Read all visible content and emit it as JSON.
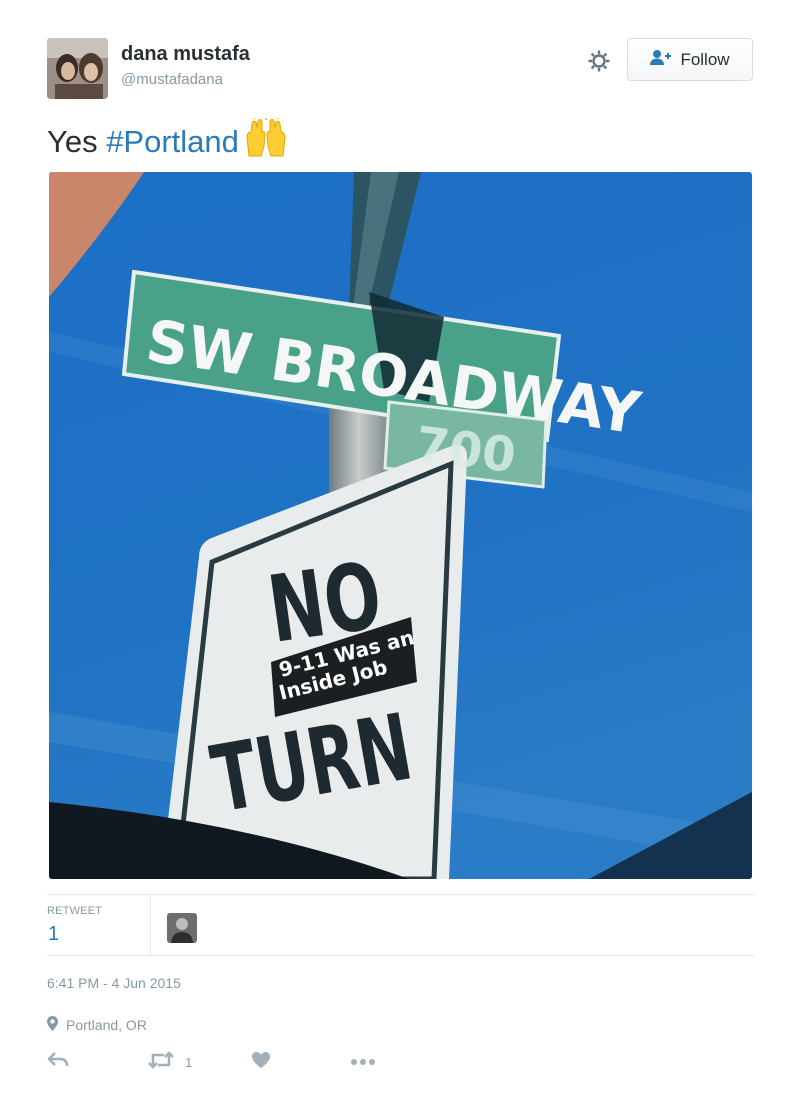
{
  "user": {
    "name": "dana mustafa",
    "handle": "@mustafadana"
  },
  "header": {
    "follow_label": "Follow"
  },
  "tweet": {
    "text_prefix": "Yes ",
    "hashtag": "#Portland",
    "emoji": "raised-hands-emoji"
  },
  "photo": {
    "street_sign": "SW BROADWAY",
    "block_number": "700",
    "regulatory_sign_top": "NO",
    "regulatory_sign_bottom": "TURN",
    "sticker_line1": "9-11 Was an",
    "sticker_line2": "Inside Job"
  },
  "stats": {
    "retweet_label": "RETWEET",
    "retweet_count": "1"
  },
  "meta": {
    "timestamp": "6:41 PM - 4 Jun 2015",
    "location": "Portland, OR"
  },
  "actions": {
    "retweet_count": "1"
  },
  "colors": {
    "link": "#2b7bb9",
    "muted": "#8899a6",
    "text": "#292f33",
    "sky": "#1f6fc2"
  }
}
